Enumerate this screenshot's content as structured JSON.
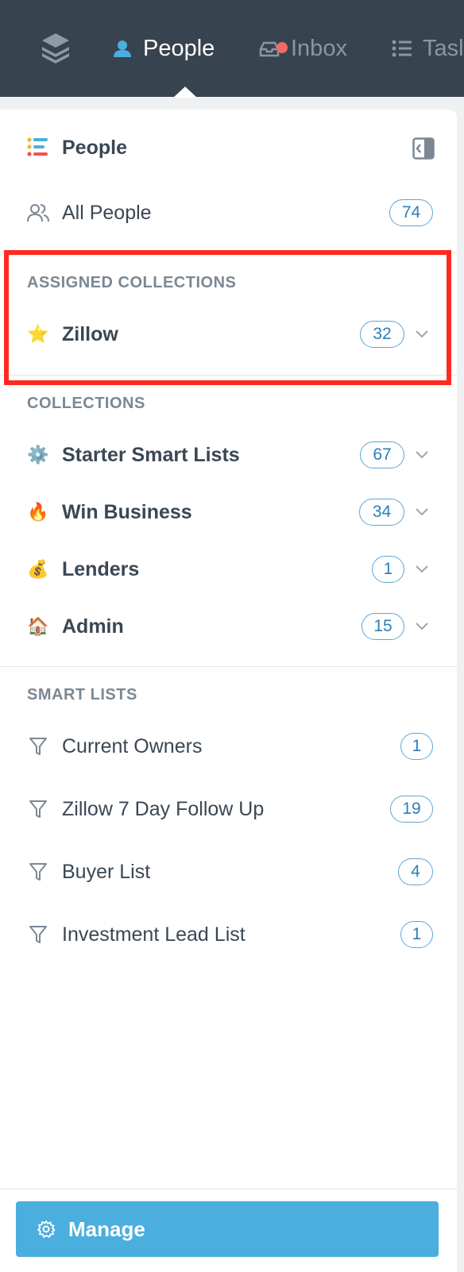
{
  "nav": {
    "items": [
      {
        "label": "People",
        "icon": "person-icon",
        "active": true
      },
      {
        "label": "Inbox",
        "icon": "inbox-icon",
        "has_notification": true
      },
      {
        "label": "Tasl",
        "icon": "list-icon"
      }
    ]
  },
  "panel": {
    "title": "People",
    "title_icon": "people-list-icon",
    "all_people": {
      "label": "All People",
      "count": "74",
      "icon": "people-icon"
    },
    "assigned_collections": {
      "title": "ASSIGNED COLLECTIONS",
      "items": [
        {
          "label": "Zillow",
          "count": "32",
          "icon": "star-emoji"
        }
      ]
    },
    "collections": {
      "title": "COLLECTIONS",
      "items": [
        {
          "label": "Starter Smart Lists",
          "count": "67",
          "icon": "gear-emoji"
        },
        {
          "label": "Win Business",
          "count": "34",
          "icon": "fire-emoji"
        },
        {
          "label": "Lenders",
          "count": "1",
          "icon": "money-bag-emoji"
        },
        {
          "label": "Admin",
          "count": "15",
          "icon": "house-emoji"
        }
      ]
    },
    "smart_lists": {
      "title": "SMART LISTS",
      "items": [
        {
          "label": "Current Owners",
          "count": "1",
          "icon": "filter-icon"
        },
        {
          "label": "Zillow 7 Day Follow Up",
          "count": "19",
          "icon": "filter-icon"
        },
        {
          "label": "Buyer List",
          "count": "4",
          "icon": "filter-icon"
        },
        {
          "label": "Investment Lead List",
          "count": "1",
          "icon": "filter-icon"
        }
      ]
    },
    "manage_label": "Manage"
  },
  "colors": {
    "nav_bg": "#37434e",
    "accent": "#4aaede",
    "highlight": "#ff2a1f",
    "badge_border": "#5aa6d6"
  }
}
